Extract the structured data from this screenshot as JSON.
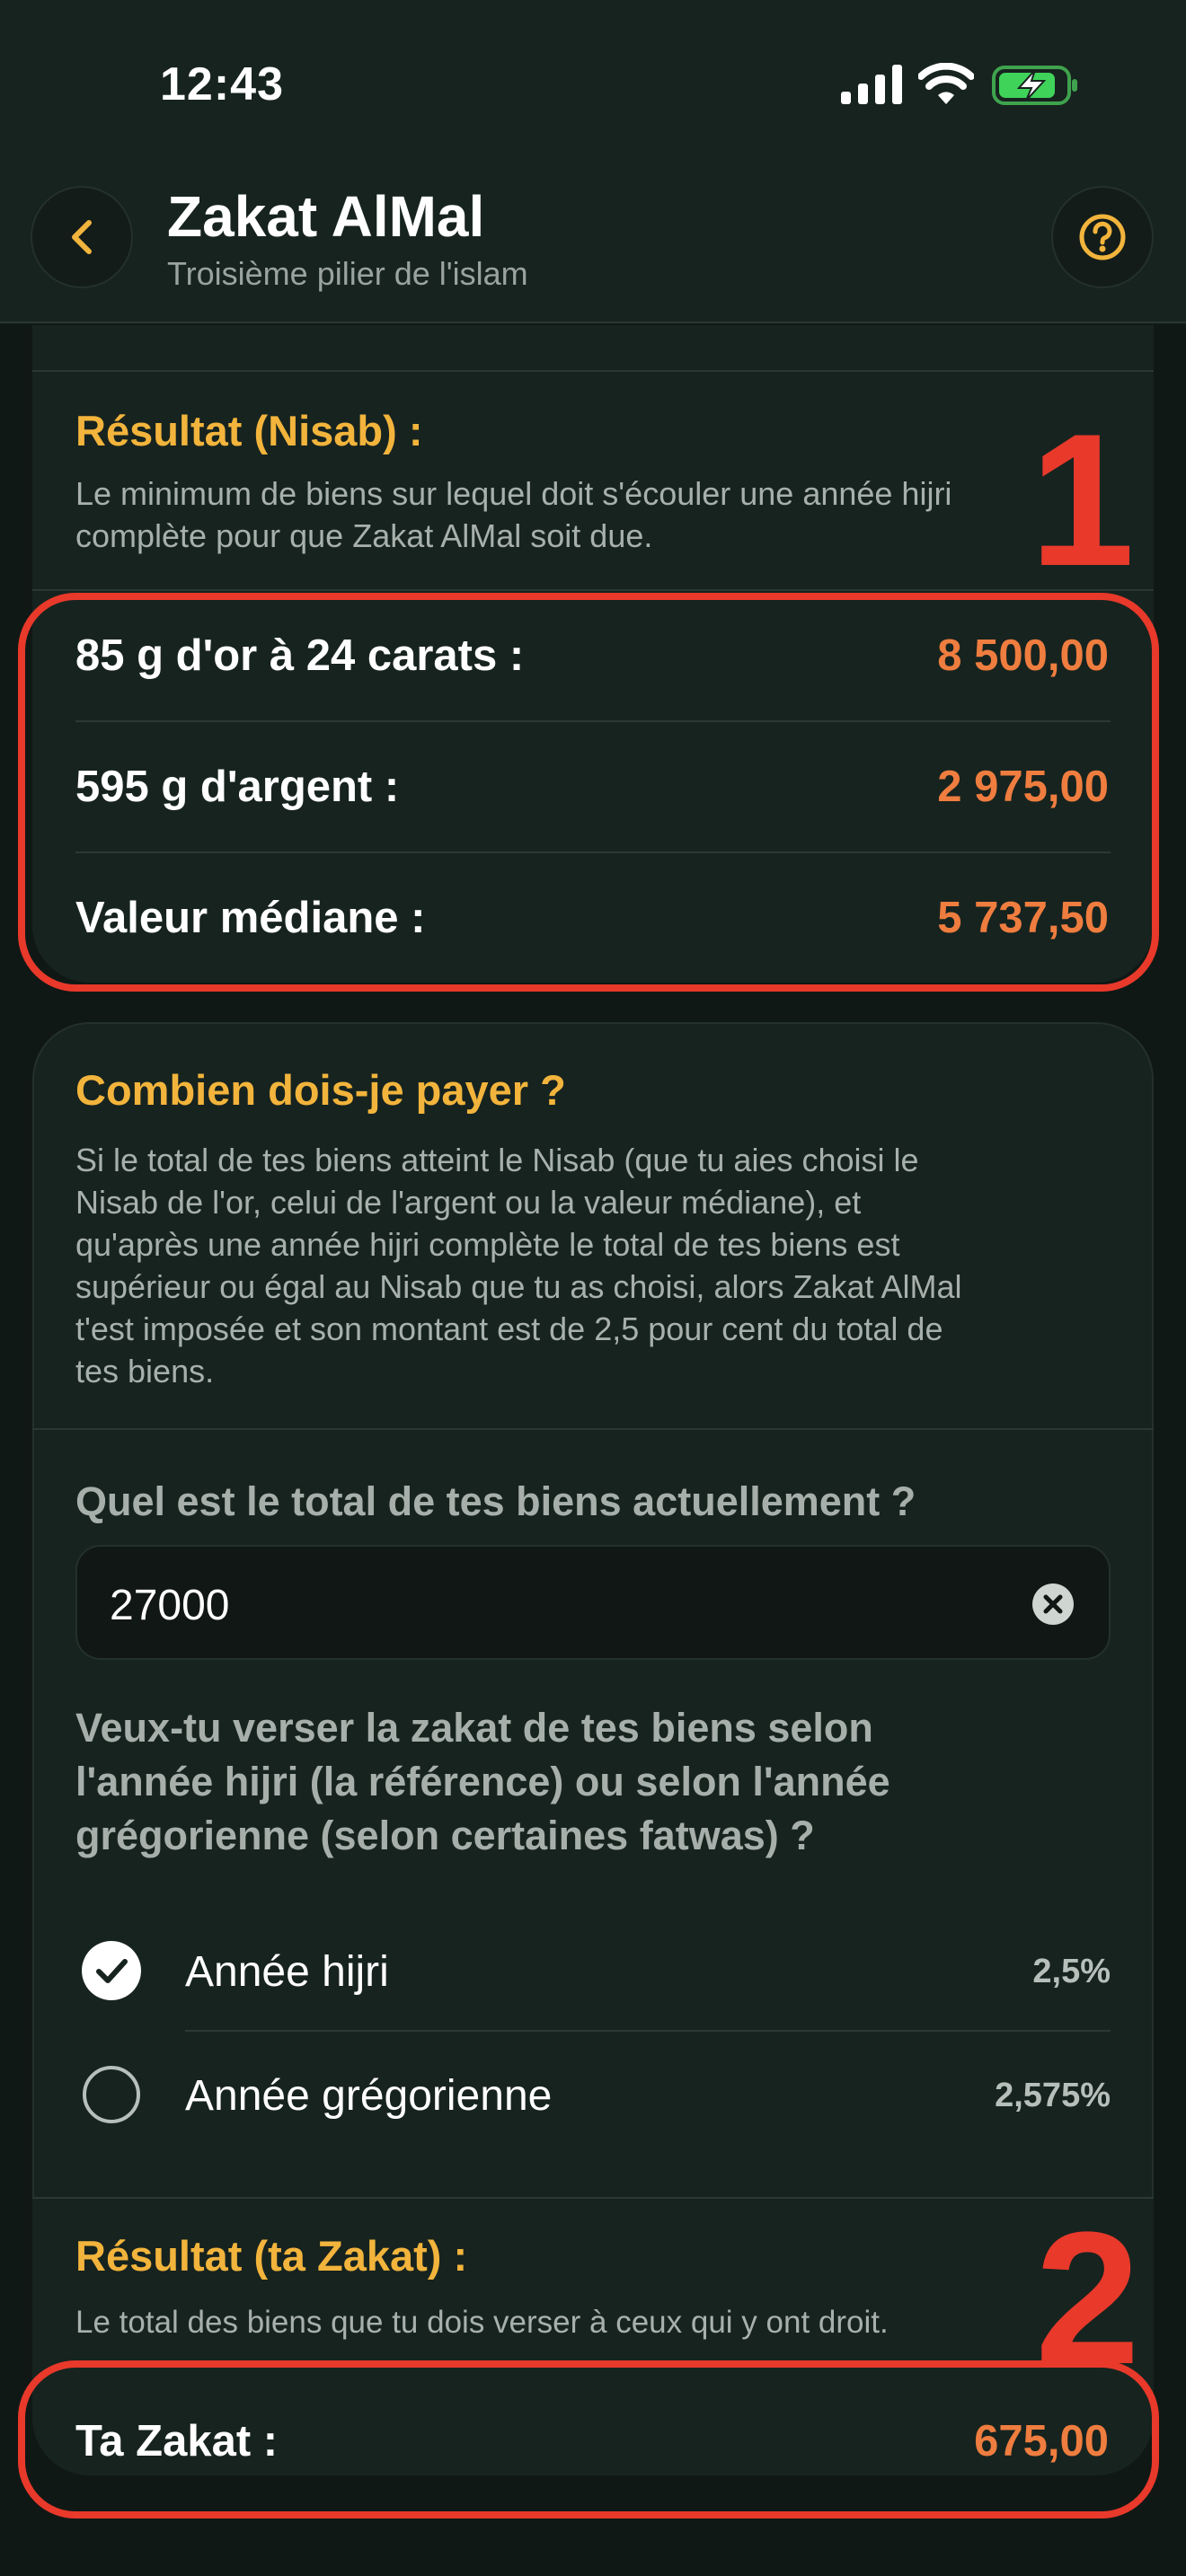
{
  "status": {
    "time": "12:43"
  },
  "header": {
    "title": "Zakat AlMal",
    "subtitle": "Troisième pilier de l'islam"
  },
  "nisab": {
    "title": "Résultat (Nisab) :",
    "desc_line1": "Le minimum de biens sur lequel doit s'écouler une année hijri",
    "desc_line2": "complète pour que Zakat AlMal soit due.",
    "rows": [
      {
        "label": "85 g d'or à 24 carats :",
        "value": "8 500,00"
      },
      {
        "label": "595 g d'argent :",
        "value": "2 975,00"
      },
      {
        "label": "Valeur médiane :",
        "value": "5 737,50"
      }
    ]
  },
  "payment": {
    "title": "Combien dois-je payer ?",
    "desc_lines": [
      "Si le total de tes biens atteint le Nisab (que tu aies choisi le",
      "Nisab de l'or, celui de l'argent ou la valeur médiane), et",
      "qu'après une année hijri complète le total de tes biens est",
      "supérieur ou égal au Nisab que tu as choisi, alors Zakat AlMal",
      "t'est imposée et son montant est de 2,5 pour cent du total de",
      "tes biens."
    ],
    "total_question": "Quel est le total de tes biens actuellement ?",
    "total_value": "27000",
    "year_question_lines": [
      "Veux-tu verser la zakat de tes biens selon",
      "l'année hijri (la référence) ou selon l'année",
      "grégorienne (selon certaines fatwas) ?"
    ],
    "options": [
      {
        "label": "Année hijri",
        "rate": "2,5%",
        "selected": true
      },
      {
        "label": "Année grégorienne",
        "rate": "2,575%",
        "selected": false
      }
    ]
  },
  "result": {
    "title": "Résultat (ta Zakat) :",
    "desc": "Le total des biens que tu dois verser à ceux qui y ont droit.",
    "label": "Ta Zakat :",
    "value": "675,00"
  },
  "annotations": {
    "marker1": "1",
    "marker2": "2",
    "color": "#e8392b"
  },
  "colors": {
    "accent_yellow": "#f2b43c",
    "value_orange": "#ee7d3f",
    "background": "#101815",
    "card": "#17231f"
  },
  "icons": {
    "back": "chevron-left-icon",
    "help": "question-circle-icon",
    "clear": "clear-circle-icon"
  }
}
